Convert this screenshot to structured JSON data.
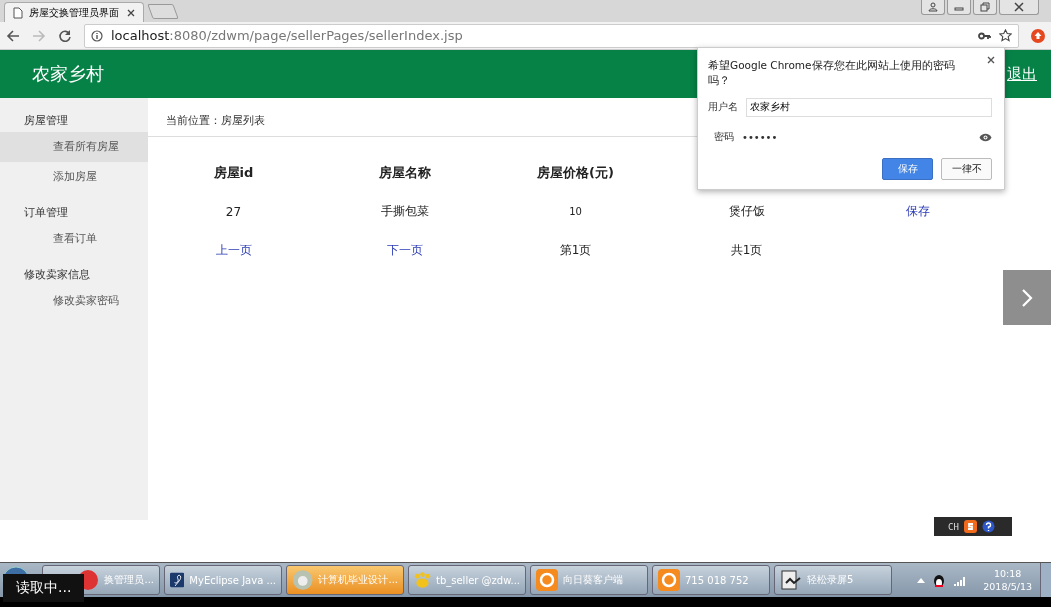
{
  "browser": {
    "tab": {
      "title": "房屋交换管理员界面"
    },
    "address": {
      "host": "localhost",
      "path": ":8080/zdwm/page/sellerPages/sellerIndex.jsp"
    }
  },
  "header": {
    "brand": "农家乡村",
    "logout": "退出"
  },
  "sidebar": [
    {
      "heading": "房屋管理",
      "items": [
        {
          "label": "查看所有房屋",
          "selected": true
        },
        {
          "label": "添加房屋",
          "selected": false
        }
      ]
    },
    {
      "heading": "订单管理",
      "items": [
        {
          "label": "查看订单",
          "selected": false
        }
      ]
    },
    {
      "heading": "修改卖家信息",
      "items": [
        {
          "label": "修改卖家密码",
          "selected": false
        }
      ]
    }
  ],
  "breadcrumb": "当前位置：房屋列表",
  "table": {
    "columns": [
      "房屋id",
      "房屋名称",
      "房屋价格(元)"
    ],
    "rows": [
      [
        {
          "text": "27",
          "kind": "text"
        },
        {
          "text": "手撕包菜",
          "kind": "text"
        },
        {
          "text": "10",
          "kind": "small"
        },
        {
          "text": "煲仔饭",
          "kind": "text"
        },
        {
          "text": "保存",
          "kind": "link"
        }
      ]
    ]
  },
  "pager": [
    {
      "text": "上一页",
      "kind": "link"
    },
    {
      "text": "下一页",
      "kind": "link"
    },
    {
      "text": "第1页",
      "kind": "text"
    },
    {
      "text": "共1页",
      "kind": "text"
    }
  ],
  "password_prompt": {
    "question": "希望Google Chrome保存您在此网站上使用的密码吗？",
    "username_label": "用户名",
    "username": "农家乡村",
    "password_label": "密码",
    "password": "••••••",
    "buttons": [
      {
        "label": "保存",
        "primary": true
      },
      {
        "label": "一律不",
        "primary": false
      }
    ]
  },
  "ime": {
    "lang": "CH"
  },
  "taskbar": {
    "items": [
      {
        "label": "换管理员...",
        "kind": "chrome",
        "selected": false
      },
      {
        "label": "MyEclipse Java ...",
        "kind": "eclipse",
        "selected": false
      },
      {
        "label": "计算机毕业设计...",
        "kind": "avatar",
        "selected": true
      },
      {
        "label": "tb_seller @zdw...",
        "kind": "paw",
        "selected": false
      },
      {
        "label": "向日葵客户端",
        "kind": "sunflower",
        "selected": false
      },
      {
        "label": "715 018 752",
        "kind": "sunflower",
        "selected": false
      },
      {
        "label": "轻松录屏5",
        "kind": "recorder",
        "selected": false
      }
    ],
    "clock": {
      "time": "10:18",
      "date": "2018/5/13"
    }
  },
  "tooltip": "读取中..."
}
